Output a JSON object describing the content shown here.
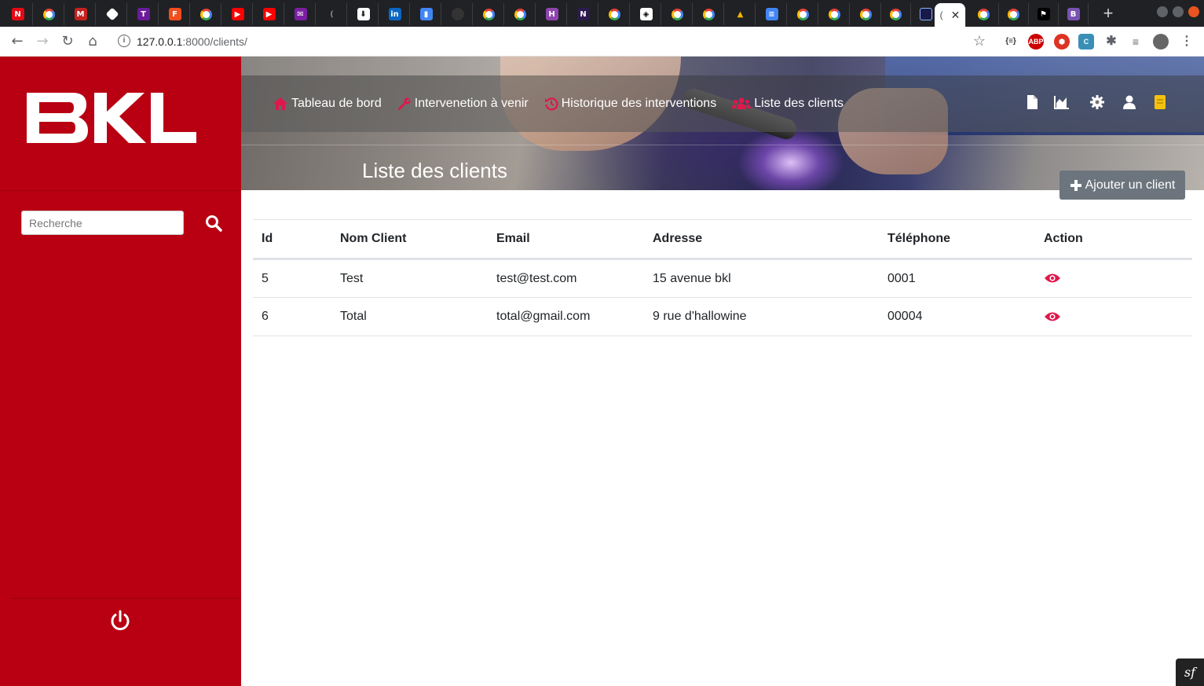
{
  "browser": {
    "url_host": "127.0.0.1",
    "url_path": ":8000/clients/",
    "tab_close": "✕",
    "new_tab": "+"
  },
  "sidebar": {
    "logo_text": "BKL",
    "search_placeholder": "Recherche"
  },
  "nav": {
    "items": [
      {
        "label": "Tableau de bord"
      },
      {
        "label": "Intervenetion à venir"
      },
      {
        "label": "Historique des interventions"
      },
      {
        "label": "Liste des clients"
      }
    ]
  },
  "page": {
    "title": "Liste des clients",
    "add_button_label": "Ajouter un client"
  },
  "table": {
    "headers": [
      "Id",
      "Nom Client",
      "Email",
      "Adresse",
      "Téléphone",
      "Action"
    ],
    "rows": [
      {
        "id": "5",
        "nom": "Test",
        "email": "test@test.com",
        "adresse": "15 avenue bkl",
        "telephone": "0001"
      },
      {
        "id": "6",
        "nom": "Total",
        "email": "total@gmail.com",
        "adresse": "9 rue d'hallowine",
        "telephone": "00004"
      }
    ]
  },
  "colors": {
    "sidebar_red": "#b80012",
    "accent_pink": "#e0174c",
    "button_gray": "#6c757d"
  }
}
